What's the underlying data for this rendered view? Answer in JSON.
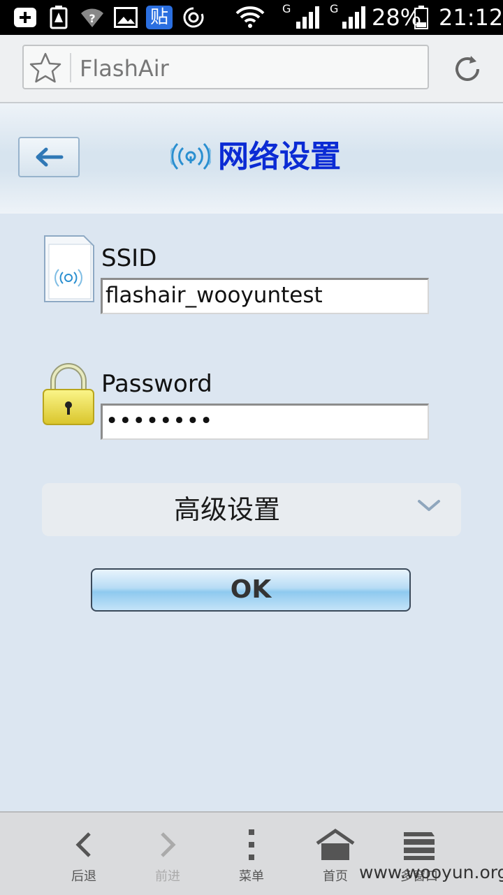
{
  "status_bar": {
    "battery_percent": "28%",
    "time": "21:12",
    "network_1": "G",
    "network_2": "G",
    "app_badge": "贴"
  },
  "browser": {
    "url": "FlashAir"
  },
  "header": {
    "title": "网络设置"
  },
  "form": {
    "ssid_label": "SSID",
    "ssid_value": "flashair_wooyuntest",
    "password_label": "Password",
    "password_value": "••••••••",
    "advanced_label": "高级设置",
    "ok_label": "OK"
  },
  "bottom_nav": {
    "items": [
      {
        "label": "后退",
        "icon": "back-icon"
      },
      {
        "label": "前进",
        "icon": "forward-icon"
      },
      {
        "label": "菜单",
        "icon": "menu-icon"
      },
      {
        "label": "首页",
        "icon": "home-icon"
      },
      {
        "label": "多窗口",
        "icon": "windows-icon"
      }
    ]
  },
  "watermark": "www.wooyun.org",
  "colors": {
    "title": "#0b2bd4",
    "page_bg": "#dce6f1",
    "ok_button": "#8ec9ef"
  }
}
